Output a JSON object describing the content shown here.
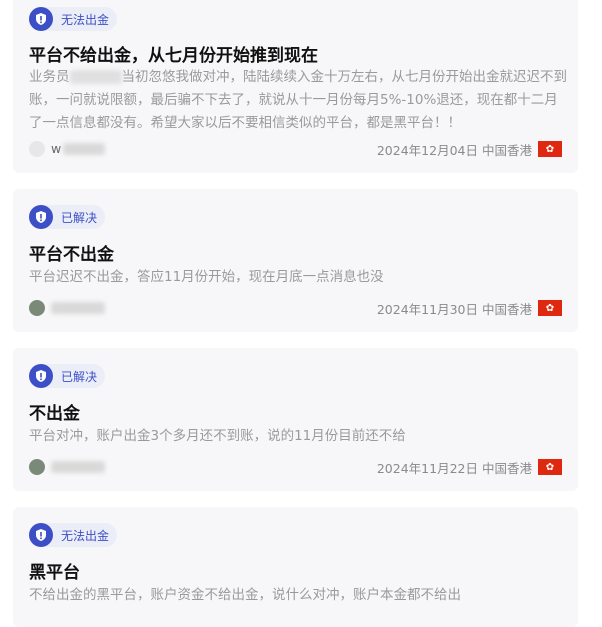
{
  "complaints": [
    {
      "status": "无法出金",
      "title": "平台不给出金，从七月份开始推到现在",
      "content_before": "业务员",
      "content_after": "当初忽悠我做对冲，陆陆续续入金十万左右，从七月份开始出金就迟迟不到账，一问就说限额，最后骗不下去了，就说从十一月份每月5%-10%退还，现在都十二月了一点信息都没有。希望大家以后不要相信类似的平台，都是黑平台！！",
      "username": "w",
      "date": "2024年12月04日",
      "region": "中国香港"
    },
    {
      "status": "已解决",
      "title": "平台不出金",
      "content": "平台迟迟不出金，答应11月份开始，现在月底一点消息也没",
      "date": "2024年11月30日",
      "region": "中国香港"
    },
    {
      "status": "已解决",
      "title": "不出金",
      "content": "平台对冲，账户出金3个多月还不到账，说的11月份目前还不给",
      "date": "2024年11月22日",
      "region": "中国香港"
    },
    {
      "status": "无法出金",
      "title": "黑平台",
      "content": "不给出金的黑平台，账户资金不给出金，说什么对冲，账户本金都不给出"
    }
  ],
  "colors": {
    "badge_accent": "#3d4fc6",
    "card_bg": "#f7f7f9",
    "flag_red": "#de2910"
  },
  "icons": {
    "badge": "alert-shield-icon",
    "flag": "hong-kong-flag-icon"
  }
}
